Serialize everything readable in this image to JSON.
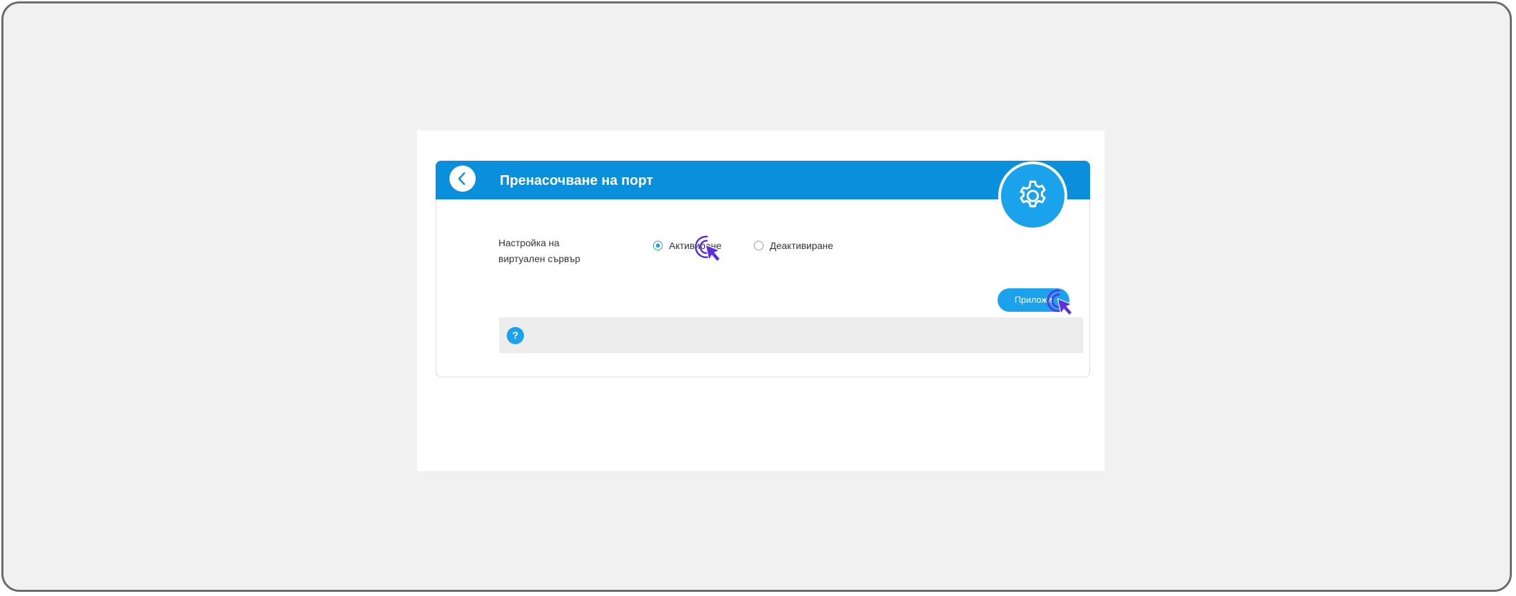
{
  "header": {
    "title": "Пренасочване на порт"
  },
  "virtual_server": {
    "label": "Настройка на виртуален сървър",
    "options": [
      {
        "label": "Активиране",
        "selected": true
      },
      {
        "label": "Деактивиране",
        "selected": false
      }
    ]
  },
  "actions": {
    "apply_label": "Приложи"
  },
  "help": {
    "icon_text": "?"
  },
  "icons": {
    "back": "chevron-left-icon",
    "settings": "gear-icon",
    "help": "question-icon",
    "pointer": "click-cursor-icon"
  },
  "colors": {
    "accent": "#0a8fdd",
    "button": "#1aa3ec",
    "cursor": "#5b2ee0",
    "frame_background": "#f1f1f1"
  }
}
